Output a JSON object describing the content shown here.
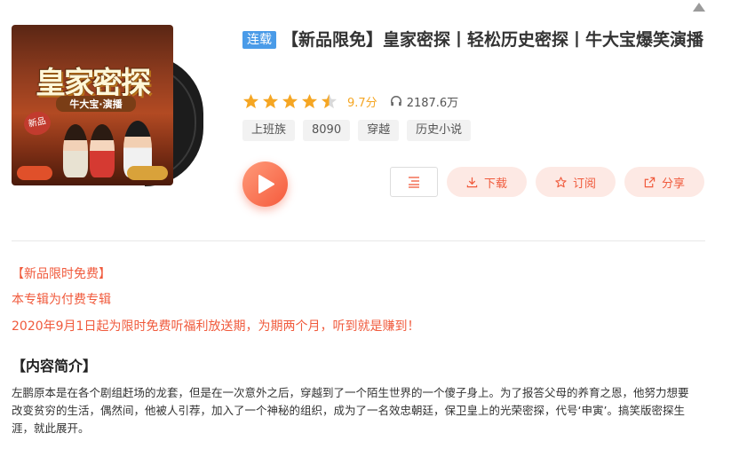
{
  "album": {
    "cover": {
      "title": "皇家密探",
      "subtitle": "牛大宝·演播",
      "badge": "新品"
    },
    "serial_tag": "连载",
    "title": "【新品限免】皇家密探丨轻松历史密探丨牛大宝爆笑演播",
    "rating": {
      "stars": 4.5,
      "max_stars": 5,
      "score_text": "9.7分"
    },
    "play_count": "2187.6万",
    "tags": [
      "上班族",
      "8090",
      "穿越",
      "历史小说"
    ]
  },
  "actions": {
    "download_label": "下载",
    "subscribe_label": "订阅",
    "share_label": "分享"
  },
  "promo": {
    "line1": "【新品限时免费】",
    "line2": "本专辑为付费专辑",
    "line3": "2020年9月1日起为限时免费听福利放送期，为期两个月，听到就是赚到！"
  },
  "intro": {
    "heading": "【内容简介】",
    "text": "左鹏原本是在各个剧组赶场的龙套，但是在一次意外之后，穿越到了一个陌生世界的一个傻子身上。为了报答父母的养育之恩，他努力想要改变贫穷的生活，偶然间，他被人引荐，加入了一个神秘的组织，成为了一名效忠朝廷，保卫皇上的光荣密探，代号‘申寅’。搞笑版密探生涯，就此展开。"
  },
  "colors": {
    "accent": "#f05a3c",
    "star": "#f5a623",
    "serial_tag": "#4a9be8",
    "pill_bg": "#fde9e4"
  },
  "icons": [
    "menu-collapse-icon",
    "star-icon",
    "headphone-icon",
    "play-icon",
    "sort-list-icon",
    "download-icon",
    "subscribe-star-icon",
    "share-icon"
  ]
}
